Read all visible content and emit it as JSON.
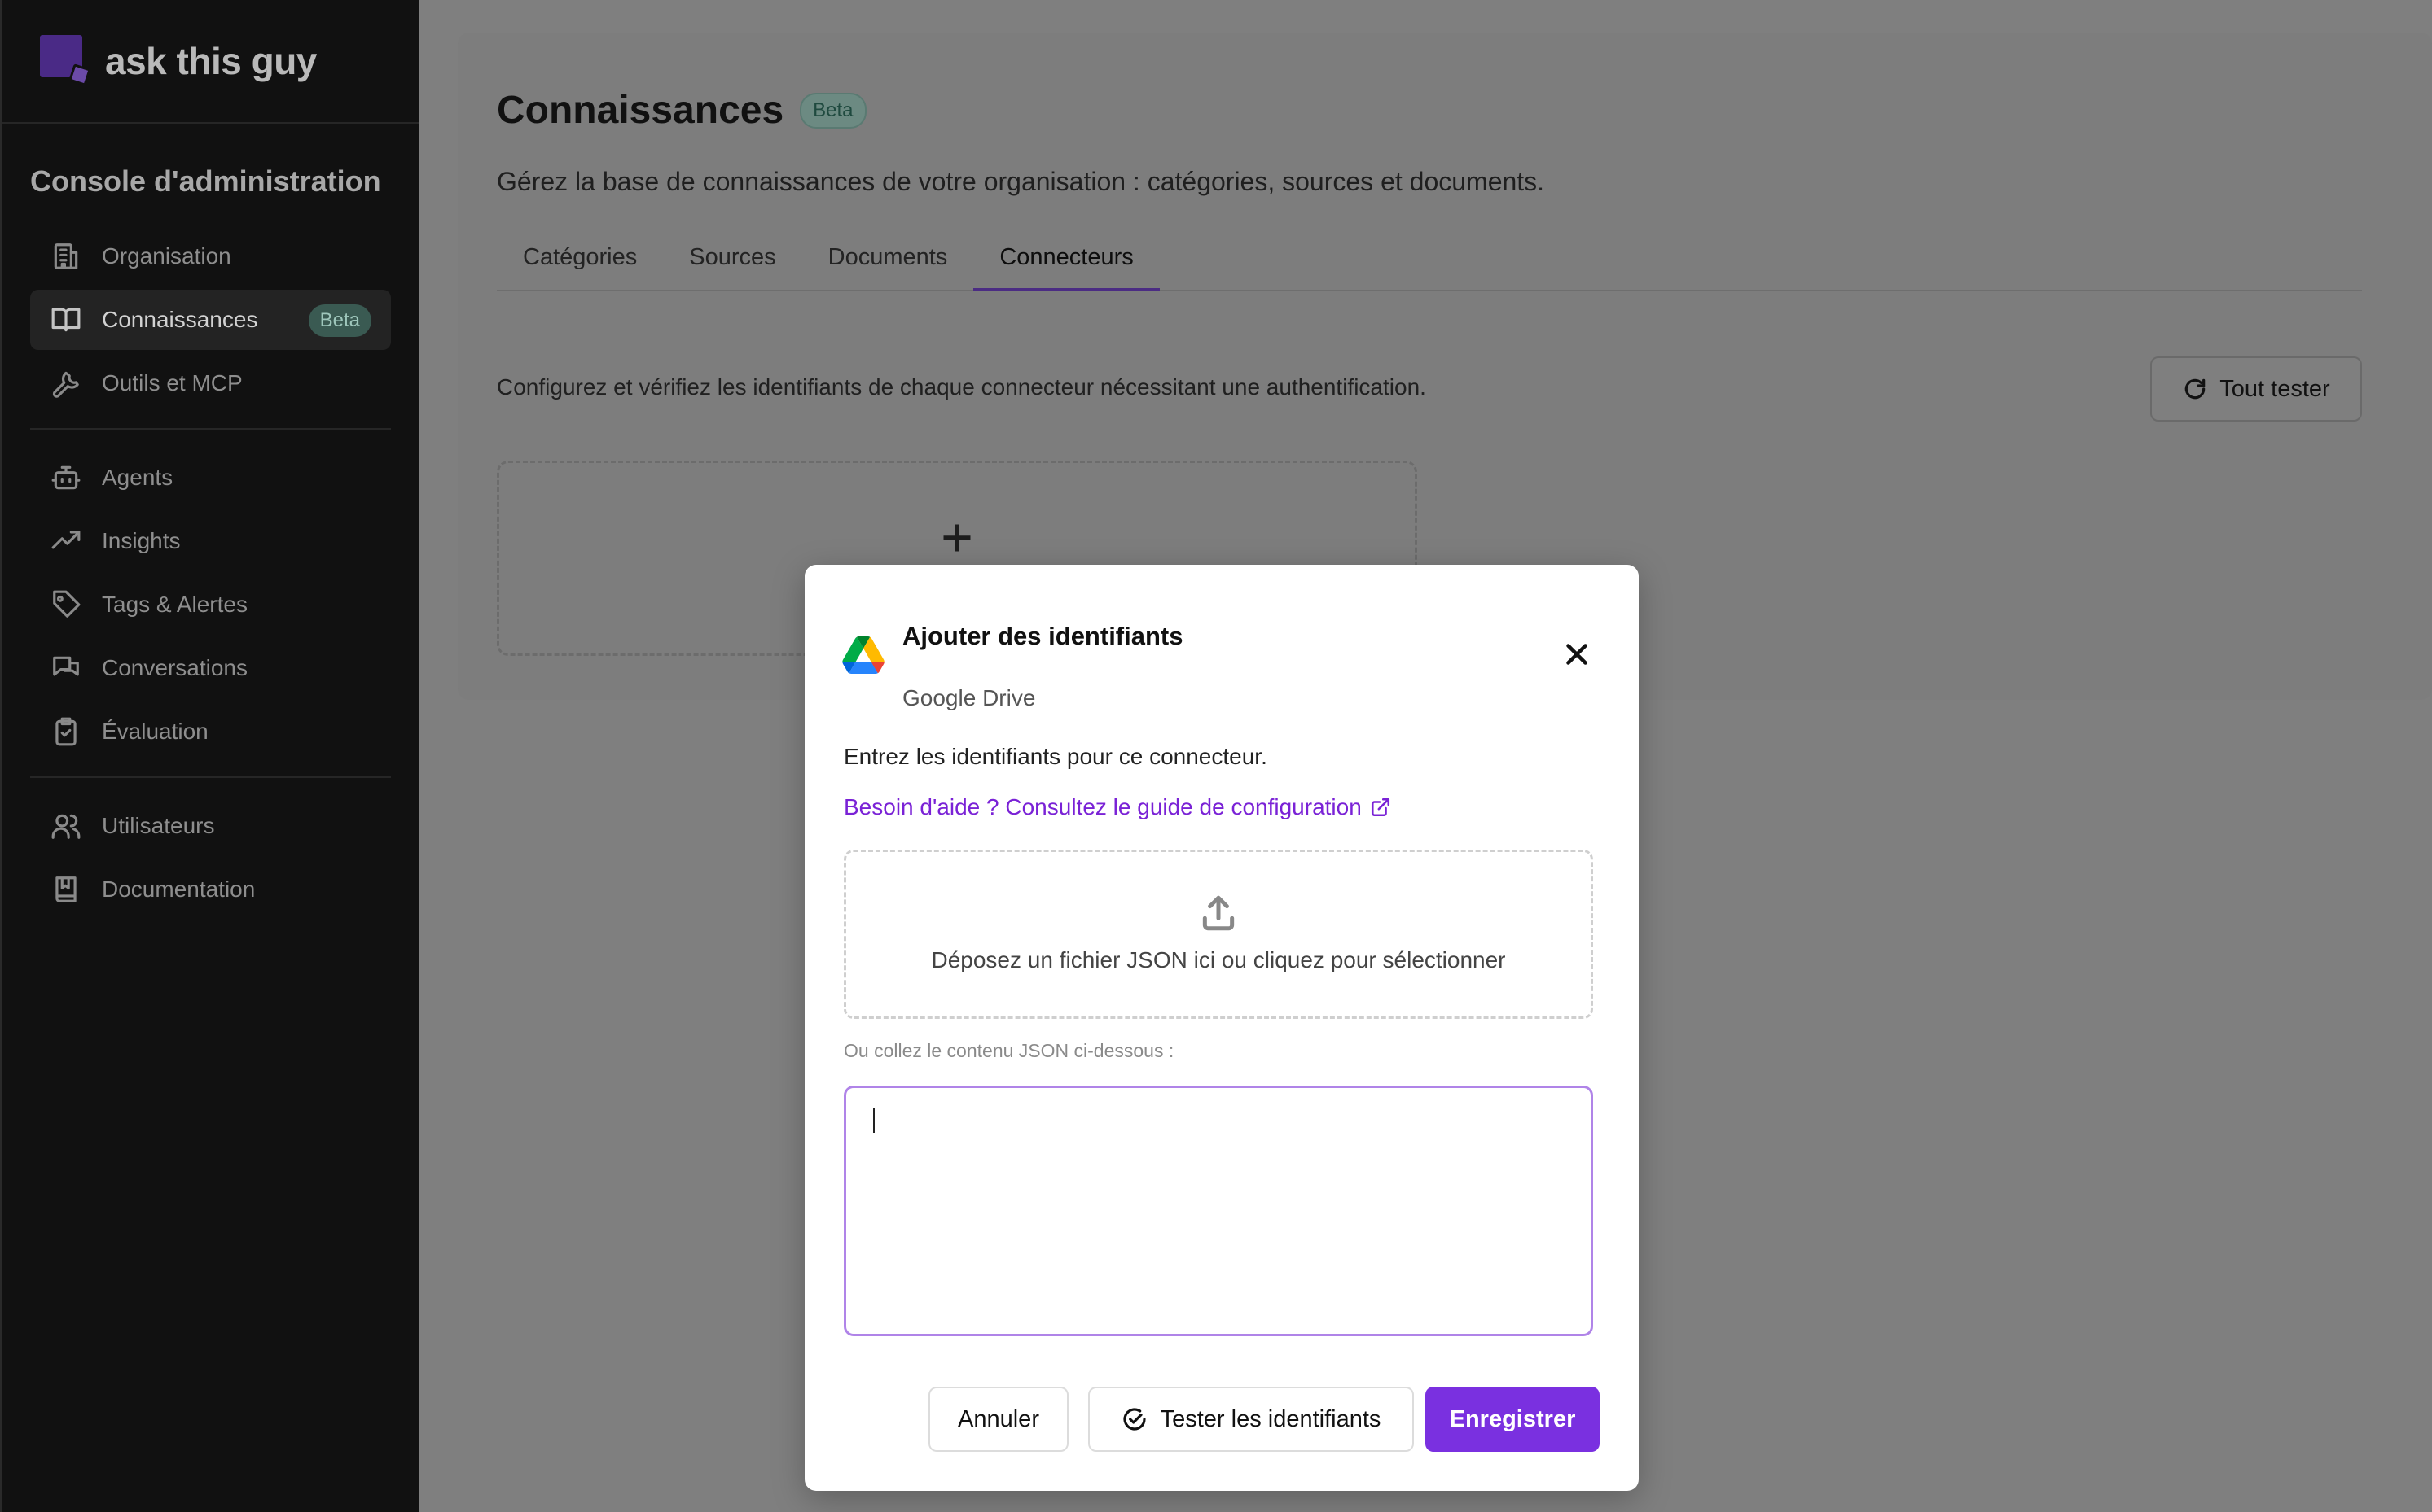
{
  "brand": {
    "name": "ask this guy",
    "logo_color": "#4a2a86"
  },
  "sidebar": {
    "section_title": "Console d'administration",
    "groups": [
      [
        {
          "label": "Organisation",
          "icon": "building-icon",
          "active": false
        },
        {
          "label": "Connaissances",
          "icon": "book-icon",
          "active": true,
          "badge": "Beta"
        },
        {
          "label": "Outils et MCP",
          "icon": "wrench-icon",
          "active": false
        }
      ],
      [
        {
          "label": "Agents",
          "icon": "robot-icon",
          "active": false
        },
        {
          "label": "Insights",
          "icon": "trending-up-icon",
          "active": false
        },
        {
          "label": "Tags & Alertes",
          "icon": "tag-icon",
          "active": false
        },
        {
          "label": "Conversations",
          "icon": "chat-icon",
          "active": false
        },
        {
          "label": "Évaluation",
          "icon": "clipboard-check-icon",
          "active": false
        }
      ],
      [
        {
          "label": "Utilisateurs",
          "icon": "users-icon",
          "active": false
        },
        {
          "label": "Documentation",
          "icon": "book-bookmark-icon",
          "active": false
        }
      ]
    ]
  },
  "main": {
    "title": "Connaissances",
    "title_badge": "Beta",
    "subtitle": "Gérez la base de connaissances de votre organisation : catégories, sources et documents.",
    "tabs": [
      {
        "label": "Catégories",
        "active": false
      },
      {
        "label": "Sources",
        "active": false
      },
      {
        "label": "Documents",
        "active": false
      },
      {
        "label": "Connecteurs",
        "active": true
      }
    ],
    "description": "Configurez et vérifiez les identifiants de chaque connecteur nécessitant une authentification.",
    "test_all_label": "Tout tester"
  },
  "modal": {
    "title": "Ajouter des identifiants",
    "connector_name": "Google Drive",
    "instruction": "Entrez les identifiants pour ce connecteur.",
    "help_link": "Besoin d'aide ? Consultez le guide de configuration",
    "dropzone_text": "Déposez un fichier JSON ici ou cliquez pour sélectionner",
    "paste_label": "Ou collez le contenu JSON ci-dessous :",
    "json_value": "",
    "cancel_label": "Annuler",
    "test_label": "Tester les identifiants",
    "save_label": "Enregistrer",
    "accent_color": "#7a30e0",
    "link_color": "#7a22d6"
  }
}
